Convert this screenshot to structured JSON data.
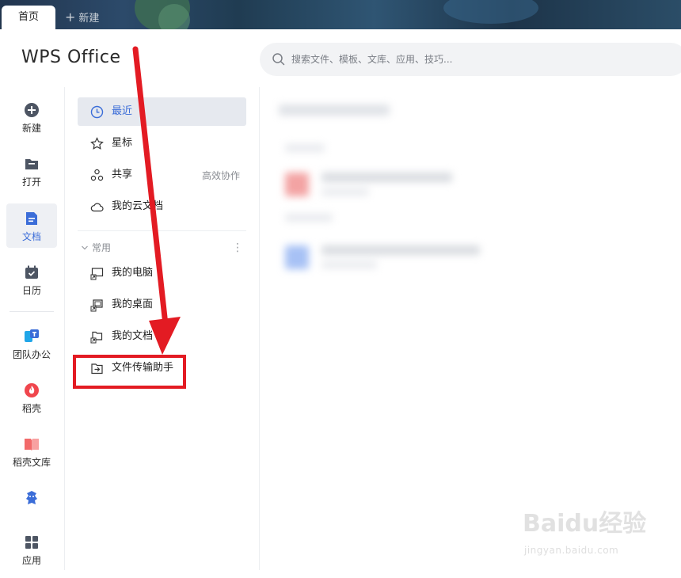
{
  "tabs": {
    "home_label": "首页",
    "new_label": "新建"
  },
  "header": {
    "logo_text": "WPS Office",
    "search_placeholder": "搜索文件、模板、文库、应用、技巧..."
  },
  "rail": {
    "items": [
      {
        "label": "新建",
        "icon": "plus-circle-icon"
      },
      {
        "label": "打开",
        "icon": "folder-icon"
      },
      {
        "label": "文档",
        "icon": "document-icon",
        "active": true
      },
      {
        "label": "日历",
        "icon": "calendar-icon"
      },
      {
        "label": "团队办公",
        "icon": "team-icon"
      },
      {
        "label": "稻壳",
        "icon": "docer-icon"
      },
      {
        "label": "稻壳文库",
        "icon": "docer-library-icon"
      },
      {
        "label": "应用",
        "icon": "apps-grid-icon"
      }
    ]
  },
  "nav": {
    "items": [
      {
        "label": "最近",
        "icon": "clock-icon",
        "active": true
      },
      {
        "label": "星标",
        "icon": "star-icon"
      },
      {
        "label": "共享",
        "icon": "share-icon",
        "extra": "高效协作"
      },
      {
        "label": "我的云文档",
        "icon": "cloud-icon"
      }
    ],
    "section_label": "常用",
    "common": [
      {
        "label": "我的电脑",
        "icon": "computer-icon"
      },
      {
        "label": "我的桌面",
        "icon": "desktop-icon"
      },
      {
        "label": "我的文档",
        "icon": "folder-doc-icon"
      },
      {
        "label": "文件传输助手",
        "icon": "file-transfer-icon"
      }
    ]
  },
  "watermark": {
    "brand": "Baidu经验",
    "url": "jingyan.baidu.com"
  },
  "colors": {
    "accent": "#3b6dd8",
    "annotation": "#e31b23",
    "active_bg": "#e6e9ef"
  }
}
